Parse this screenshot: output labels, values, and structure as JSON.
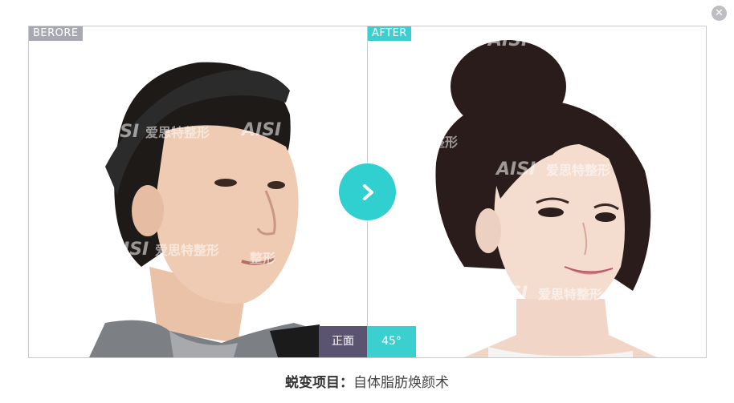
{
  "close_icon": "close-icon",
  "before": {
    "tag": "BERORE"
  },
  "after": {
    "tag": "AFTER"
  },
  "watermark": {
    "brand": "AISI",
    "text": "爱思特整形"
  },
  "views": {
    "front": "正面",
    "angle45": "45°"
  },
  "caption": {
    "label": "蜕变项目：",
    "value": "自体脂肪焕颜术"
  },
  "colors": {
    "accent": "#3ccfd0",
    "tag_before": "#a8a8b3",
    "front_button": "#5a5470"
  }
}
